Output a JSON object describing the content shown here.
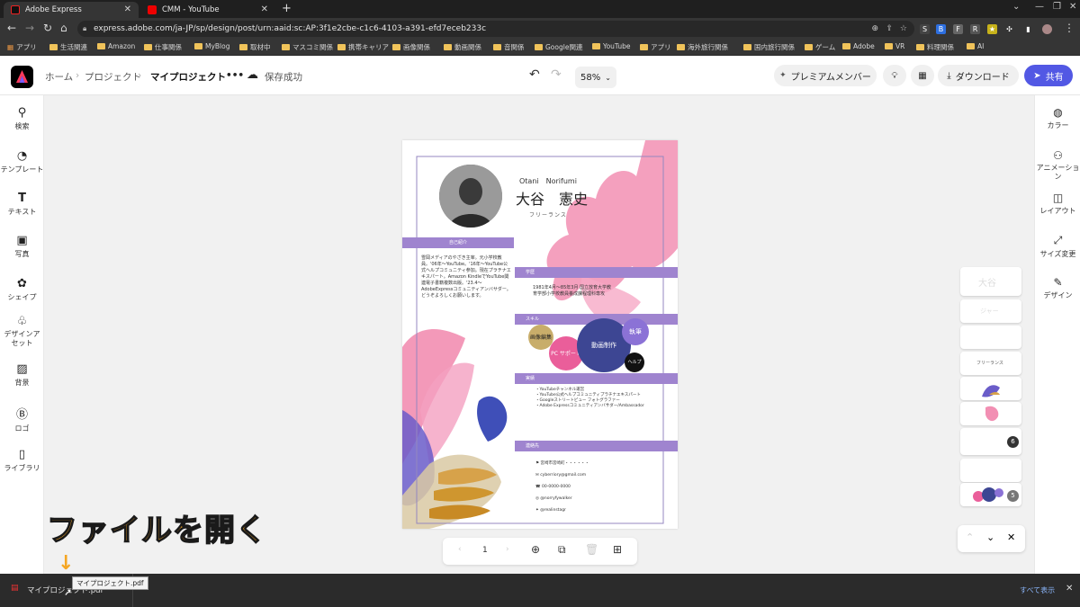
{
  "browser": {
    "tabs": [
      {
        "title": "Adobe Express",
        "active": true
      },
      {
        "title": "CMM - YouTube",
        "active": false
      }
    ],
    "url": "express.adobe.com/ja-JP/sp/design/post/urn:aaid:sc:AP:3f1e2cbe-c1c6-4103-a391-efd7eceb233c",
    "bookmarks": [
      "アプリ",
      "生活関連",
      "Amazon",
      "仕事関係",
      "MyBlog",
      "取材中",
      "マスコミ関係",
      "携帯キャリア",
      "画像関係",
      "動画関係",
      "音関係",
      "Google関連",
      "YouTube",
      "アプリ",
      "海外旅行関係",
      "国内旅行関係",
      "ゲーム",
      "Adobe",
      "VR",
      "料理関係",
      "AI"
    ]
  },
  "header": {
    "home": "ホーム",
    "projects": "プロジェクト",
    "current": "マイプロジェクト",
    "more": "•••",
    "save_status": "保存成功",
    "zoom": "58%",
    "premium": "プレミアムメンバー",
    "download": "ダウンロード",
    "share": "共有"
  },
  "left_sidebar": [
    {
      "label": "検索",
      "icon": "search-icon"
    },
    {
      "label": "テンプレート",
      "icon": "template-icon"
    },
    {
      "label": "テキスト",
      "icon": "text-icon"
    },
    {
      "label": "写真",
      "icon": "photo-icon"
    },
    {
      "label": "シェイプ",
      "icon": "shape-icon"
    },
    {
      "label": "デザインアセット",
      "icon": "design-assets-icon"
    },
    {
      "label": "背景",
      "icon": "background-icon"
    },
    {
      "label": "ロゴ",
      "icon": "logo-icon"
    },
    {
      "label": "ライブラリ",
      "icon": "library-icon"
    }
  ],
  "right_sidebar": [
    {
      "label": "カラー",
      "icon": "color-icon"
    },
    {
      "label": "アニメーション",
      "icon": "animation-icon"
    },
    {
      "label": "レイアウト",
      "icon": "layout-icon"
    },
    {
      "label": "サイズ変更",
      "icon": "resize-icon"
    },
    {
      "label": "デザイン",
      "icon": "design-icon"
    }
  ],
  "document": {
    "name_en": "Otani　Norifumi",
    "name_jp": "大谷　憲史",
    "role": "フリーランス",
    "section_intro": "自己紹介",
    "intro_text": "雪岡メディアのやざき主宰。元小学校教員。'06年〜YouTube。'16年〜YouTube公式ヘルプコミュニティ参加。現在プラチナエキスパート。Amazon KindleでYouTube関連電子書籍複数出版。'23.4〜AdobeExpressコミュニティアンバサダー。どうぞよろしくお願いします。",
    "section_edu": "学歴",
    "edu_text": "1981年4月〜85年3月 国立放育大学教育学部小学校教員養成課程理科専攻",
    "section_skill": "スキル",
    "skills": [
      "画像編集",
      "PC サポート",
      "動画制作",
      "執筆",
      "ヘルプ"
    ],
    "section_results": "実績",
    "results": [
      "・YouTubeチャンネル運営",
      "・YouTube公式ヘルプコミュニティプラチナエキスパート",
      "・Googleストリートビュー フォトグラファー",
      "・Adobe Expressコミュニティアンバサダー/Ambassador"
    ],
    "section_contact": "連絡先",
    "contacts": [
      "宮崎市宮崎町・・・・・・",
      "cyberriory@gmail.com",
      "00-0000-0000",
      "@norryfywalker",
      "@realinstagr"
    ]
  },
  "pager": {
    "page": "1"
  },
  "thumbnails": {
    "badge1": "6",
    "badge2": "5",
    "label": "フリーランス",
    "text1": "大谷",
    "text2": "ジャー"
  },
  "caption": "ファイルを開く",
  "download_bar": {
    "file": "マイプロジェクト.pdf",
    "tooltip": "マイプロジェクト.pdf",
    "show_all": "すべて表示"
  },
  "colors": {
    "accent": "#5258e4",
    "band": "#9f84cf",
    "skill_navy": "#3d4693",
    "skill_pink": "#ea5e9a",
    "skill_purple": "#8b72d6"
  }
}
